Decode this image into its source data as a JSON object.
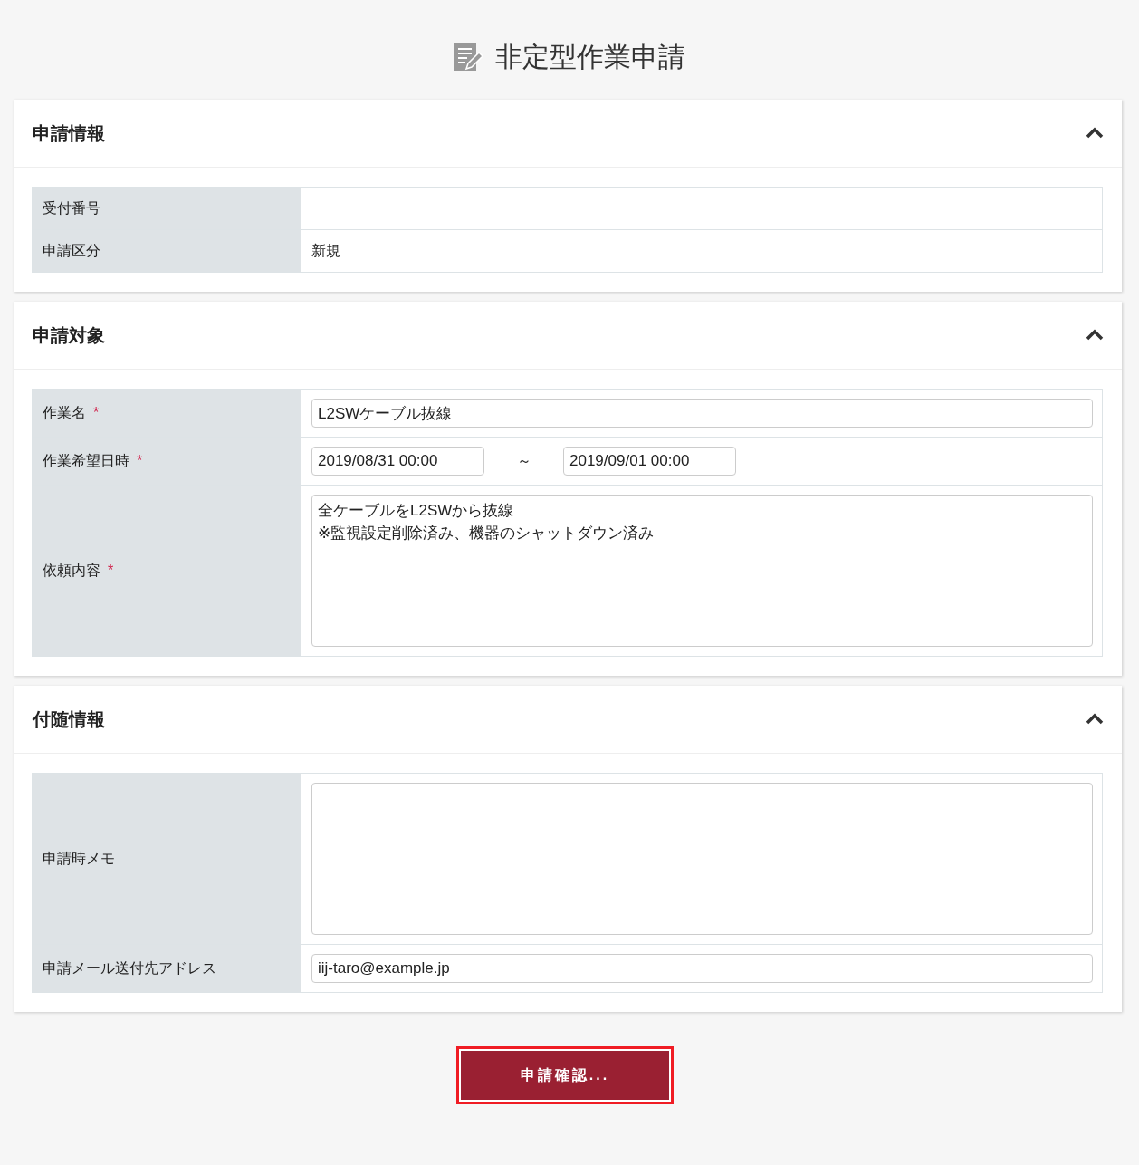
{
  "page_title": "非定型作業申請",
  "sections": [
    {
      "title": "申請情報",
      "expanded": true,
      "rows": [
        {
          "label": "受付番号",
          "kind": "text",
          "value": ""
        },
        {
          "label": "申請区分",
          "kind": "text",
          "value": "新規"
        }
      ]
    },
    {
      "title": "申請対象",
      "expanded": true,
      "rows": [
        {
          "label": "作業名",
          "required_mark": "*",
          "kind": "input",
          "value": "L2SWケーブル抜線"
        },
        {
          "label": "作業希望日時",
          "required_mark": "*",
          "kind": "daterange",
          "start": "2019/08/31 00:00",
          "separator": "～",
          "end": "2019/09/01 00:00"
        },
        {
          "label": "依頼内容",
          "required_mark": "*",
          "kind": "textarea",
          "value": "全ケーブルをL2SWから抜線\n※監視設定削除済み、機器のシャットダウン済み"
        }
      ]
    },
    {
      "title": "付随情報",
      "expanded": true,
      "rows": [
        {
          "label": "申請時メモ",
          "kind": "textarea",
          "value": ""
        },
        {
          "label": "申請メール送付先アドレス",
          "kind": "input",
          "value": "iij-taro@example.jp"
        }
      ]
    }
  ],
  "submit_button": "申請確認..."
}
